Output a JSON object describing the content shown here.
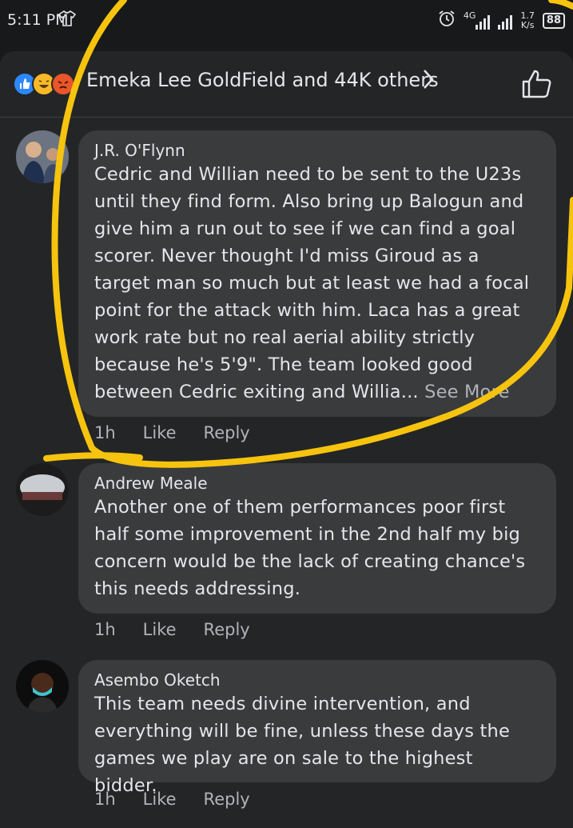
{
  "status_bar": {
    "time": "5:11 PM",
    "network": "4G",
    "speed_value": "1.7",
    "speed_unit": "K/s",
    "battery": "88"
  },
  "reactions": {
    "summary": "Emeka Lee GoldField and 44K others",
    "icons": [
      "like-icon",
      "haha-icon",
      "angry-icon"
    ]
  },
  "comments": [
    {
      "author": "J.R. O'Flynn",
      "text": "Cedric and Willian need to be sent to the U23s until they find form. Also bring up Balogun and give him a run out to see if we can find a goal scorer. Never thought I'd miss Giroud as a target man so much but at least we had a focal point for the attack with him. Laca has a great work rate but no real aerial ability strictly because he's 5'9\". The team looked good between Cedric exiting and Willia...",
      "see_more": "See More",
      "time": "1h",
      "like": "Like",
      "reply": "Reply"
    },
    {
      "author": "Andrew Meale",
      "text": "Another one of them performances poor first half some improvement in the 2nd half my big concern would be the lack of creating chance's this needs addressing.",
      "time": "1h",
      "like": "Like",
      "reply": "Reply"
    },
    {
      "author": "Asembo Oketch",
      "text": "This team needs divine intervention, and everything will be fine, unless these days the games we play are on sale to the highest bidder.",
      "time": "1h",
      "like": "Like",
      "reply": "Reply"
    }
  ],
  "colors": {
    "background": "#18191a",
    "panel": "#242526",
    "bubble": "#3a3b3c",
    "primary_text": "#e4e6eb",
    "secondary_text": "#b0b3b8",
    "annotation": "#f6c40e"
  }
}
